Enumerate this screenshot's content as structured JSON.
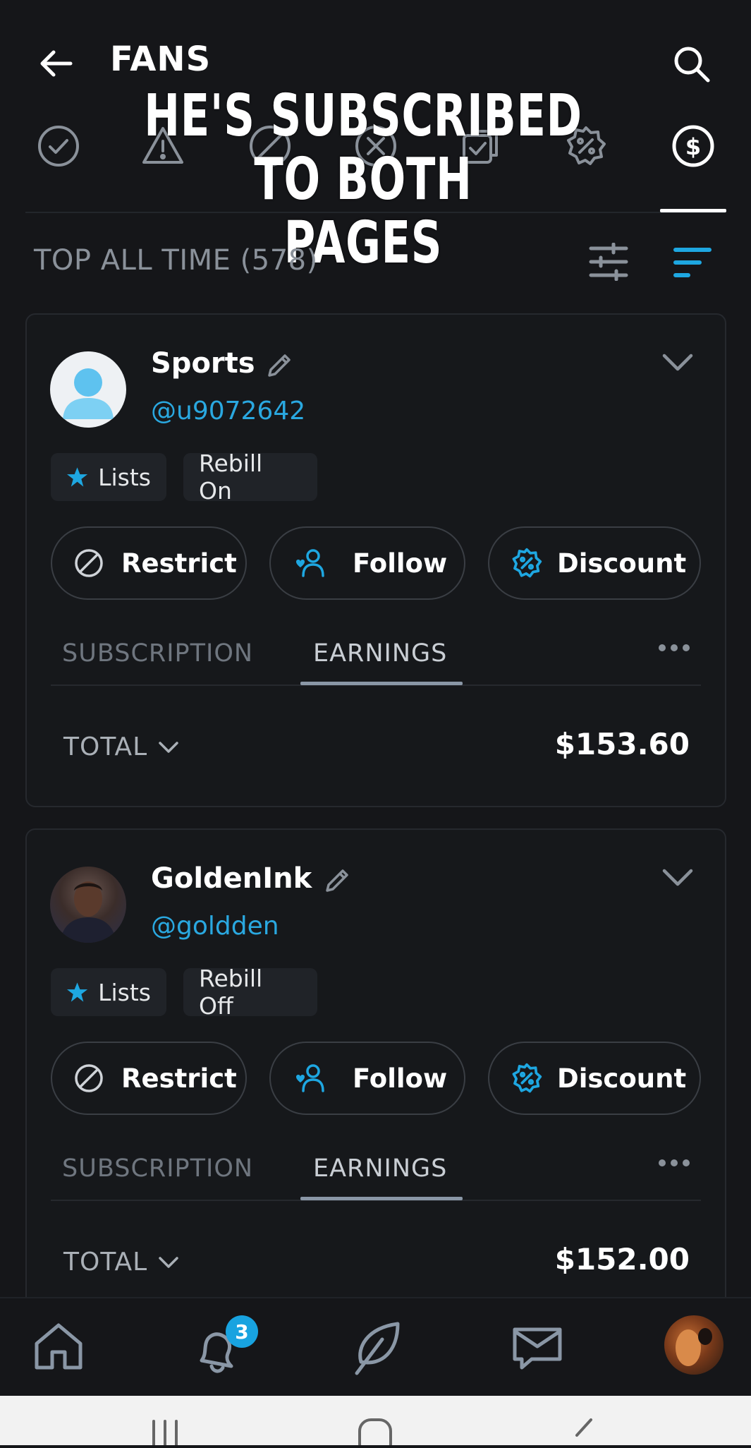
{
  "header": {
    "title": "FANS",
    "caption_line1": "HE'S SUBSCRIBED TO BOTH",
    "caption_line2": "PAGES"
  },
  "filter_tabs": [
    "check",
    "warning",
    "restricted",
    "blocked",
    "selected",
    "discount",
    "earnings"
  ],
  "section": {
    "title": "TOP ALL TIME (578)"
  },
  "fans": [
    {
      "name": "Sports",
      "handle": "@u9072642",
      "lists_label": "Lists",
      "rebill": "Rebill On",
      "restrict_label": "Restrict",
      "follow_label": "Follow",
      "discount_label": "Discount",
      "tab_subscription": "SUBSCRIPTION",
      "tab_earnings": "EARNINGS",
      "total_label": "TOTAL",
      "total_amount": "$153.60"
    },
    {
      "name": "GoldenInk",
      "handle": "@goldden",
      "lists_label": "Lists",
      "rebill": "Rebill Off",
      "restrict_label": "Restrict",
      "follow_label": "Follow",
      "discount_label": "Discount",
      "tab_subscription": "SUBSCRIPTION",
      "tab_earnings": "EARNINGS",
      "total_label": "TOTAL",
      "total_amount": "$152.00"
    }
  ],
  "bottom_nav": {
    "notification_count": "3",
    "items": [
      "home",
      "notifications",
      "add-post",
      "messages",
      "profile"
    ]
  },
  "colors": {
    "accent": "#1ea7e1",
    "background": "#151619",
    "card": "#16181b"
  }
}
